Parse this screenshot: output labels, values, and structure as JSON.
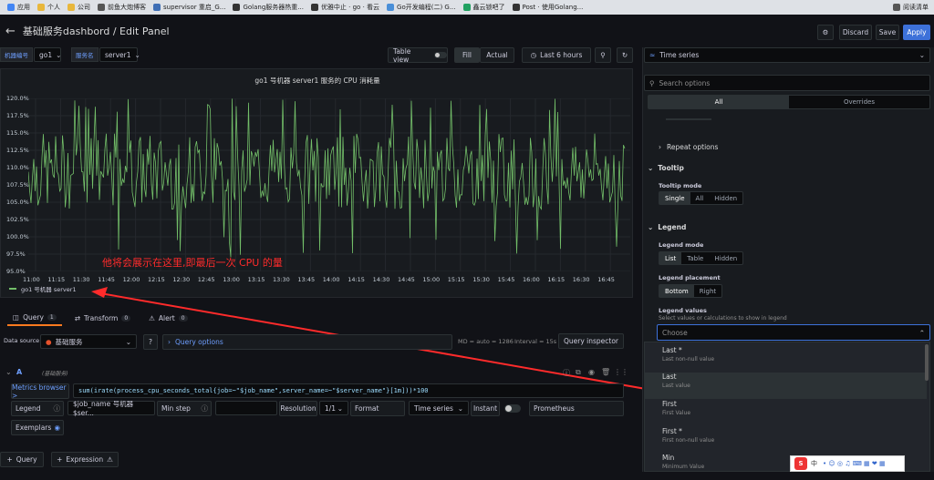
{
  "bookmarks": [
    "应用",
    "个人",
    "公司",
    "前鱼大炮博客",
    "supervisor 重启_G...",
    "Golang服务器热重...",
    "优雅中止 · go · 看云",
    "Go开发编程(二) G...",
    "鑫云锁吧了",
    "Post · 使用Golang...",
    "阅读清单"
  ],
  "header": {
    "title": "基础服务dashbord / Edit Panel",
    "discard": "Discard",
    "save": "Save",
    "apply": "Apply"
  },
  "vars": {
    "label1": "机器编号",
    "value1": "go1",
    "label2": "服务名",
    "value2": "server1"
  },
  "toolbar": {
    "table_view": "Table view",
    "fill": "Fill",
    "actual": "Actual",
    "time_range": "Last 6 hours"
  },
  "panel": {
    "title": "go1 号机器 server1 服务的 CPU 消耗量",
    "legend": "go1 号机器 server1",
    "y_ticks": [
      "120.0%",
      "117.5%",
      "115.0%",
      "112.5%",
      "110.0%",
      "107.5%",
      "105.0%",
      "102.5%",
      "100.0%",
      "97.5%",
      "95.0%"
    ],
    "x_ticks": [
      "11:00",
      "11:15",
      "11:30",
      "11:45",
      "12:00",
      "12:15",
      "12:30",
      "12:45",
      "13:00",
      "13:15",
      "13:30",
      "13:45",
      "14:00",
      "14:15",
      "14:30",
      "14:45",
      "15:00",
      "15:15",
      "15:30",
      "15:45",
      "16:00",
      "16:15",
      "16:30",
      "16:45"
    ],
    "annotation": "他将会展示在这里,即最后一次 CPU 的量"
  },
  "chart_data": {
    "type": "line",
    "title": "go1 号机器 server1 服务的 CPU 消耗量",
    "series": [
      {
        "name": "go1 号机器 server1",
        "y_range": [
          97,
          120
        ],
        "typical": [
          104,
          115
        ]
      }
    ],
    "x_range": [
      "11:00",
      "16:50"
    ],
    "ylim": [
      95,
      120
    ],
    "grid": true,
    "legend": "bottom-left",
    "color": "#73bf69"
  },
  "query_tabs": [
    {
      "label": "Query",
      "count": "1"
    },
    {
      "label": "Transform",
      "count": "0"
    },
    {
      "label": "Alert",
      "count": "0"
    }
  ],
  "query": {
    "ds_label": "Data source",
    "ds": "基础服务",
    "options": "Query options",
    "meta": "MD = auto = 1286",
    "interval": "Interval = 15s",
    "inspector": "Query inspector",
    "ref": "A",
    "ref_ds": "(基础服务)",
    "metrics_browser": "Metrics browser >",
    "expr": "sum(irate(process_cpu_seconds_total{job=~\"$job_name\",server_name=~\"$server_name\"}[1m]))*100",
    "legend_label": "Legend",
    "legend_value": "$job_name 号机器 $ser...",
    "minstep": "Min step",
    "resolution": "Resolution",
    "res_value": "1/1",
    "format": "Format",
    "format_value": "Time series",
    "instant": "Instant",
    "prometheus": "Prometheus",
    "exemplars": "Exemplars",
    "add_query": "Query",
    "add_expr": "Expression"
  },
  "side": {
    "viz": "Time series",
    "search": "Search options",
    "all": "All",
    "overrides": "Overrides",
    "repeat": "Repeat options",
    "tooltip": "Tooltip",
    "tooltip_mode": "Tooltip mode",
    "tt_opts": [
      "Single",
      "All",
      "Hidden"
    ],
    "legend": "Legend",
    "legend_mode": "Legend mode",
    "lm_opts": [
      "List",
      "Table",
      "Hidden"
    ],
    "legend_placement": "Legend placement",
    "lp_opts": [
      "Bottom",
      "Right"
    ],
    "legend_values": "Legend values",
    "lv_desc": "Select values or calculations to show in legend",
    "choose": "Choose",
    "options": [
      {
        "t": "Last *",
        "d": "Last non-null value"
      },
      {
        "t": "Last",
        "d": "Last value"
      },
      {
        "t": "First",
        "d": "First Value"
      },
      {
        "t": "First *",
        "d": "First non-null value"
      },
      {
        "t": "Min",
        "d": "Minimum Value"
      }
    ]
  },
  "ime": {
    "label": "中"
  }
}
